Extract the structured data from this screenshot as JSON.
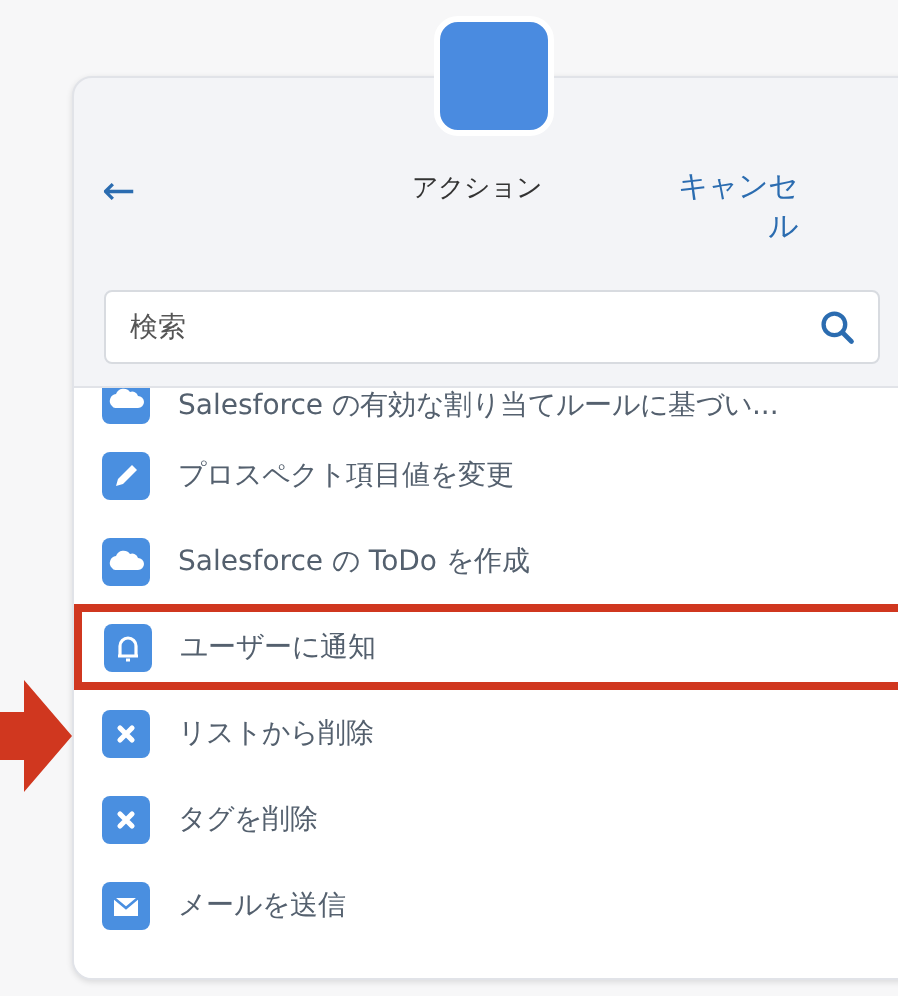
{
  "header": {
    "back": "←",
    "title": "アクション",
    "cancel": "キャンセル"
  },
  "search": {
    "placeholder": "検索"
  },
  "actions": [
    {
      "label": "Salesforce の有効な割り当てルールに基づい...",
      "kind": "cloud",
      "highlighted": false
    },
    {
      "label": "プロスペクト項目値を変更",
      "kind": "pencil",
      "highlighted": false
    },
    {
      "label": "Salesforce の ToDo を作成",
      "kind": "cloud",
      "highlighted": false
    },
    {
      "label": "ユーザーに通知",
      "kind": "bell",
      "highlighted": true
    },
    {
      "label": "リストから削除",
      "kind": "remove",
      "highlighted": false
    },
    {
      "label": "タグを削除",
      "kind": "remove",
      "highlighted": false
    },
    {
      "label": "メールを送信",
      "kind": "mail",
      "highlighted": false
    }
  ]
}
